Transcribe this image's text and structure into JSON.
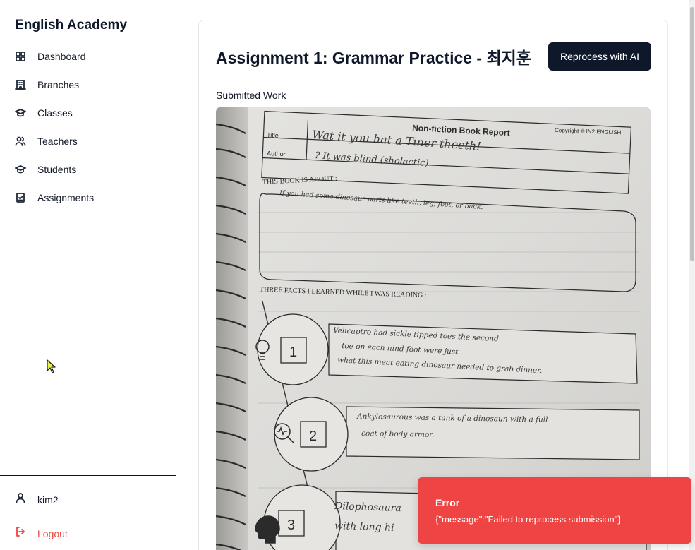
{
  "sidebar": {
    "brand": "English Academy",
    "items": [
      {
        "label": "Dashboard",
        "icon": "dashboard-icon"
      },
      {
        "label": "Branches",
        "icon": "building-icon"
      },
      {
        "label": "Classes",
        "icon": "graduation-cap-icon"
      },
      {
        "label": "Teachers",
        "icon": "users-icon"
      },
      {
        "label": "Students",
        "icon": "graduation-cap-icon"
      },
      {
        "label": "Assignments",
        "icon": "clipboard-check-icon"
      }
    ],
    "user": "kim2",
    "logout": "Logout"
  },
  "main": {
    "title": "Assignment 1: Grammar Practice - 최지훈",
    "reprocess_label": "Reprocess with AI",
    "section_label": "Submitted Work"
  },
  "worksheet": {
    "heading": "Non-fiction Book Report",
    "copyright": "Copyright © IN2 ENGLISH",
    "title_label": "Title",
    "author_label": "Author",
    "title_value": "Wat it you hat a Tiner theeth!",
    "author_value": "? It was blind (sholactic)",
    "about_heading": "THIS BOOK IS ABOUT :",
    "about_text": "If you had some dinosaur parts like teeth, leg, foot, or back.",
    "facts_heading": "THREE FACTS I LEARNED WHILE I WAS READING :",
    "facts": [
      {
        "num": "1",
        "text1": "Velicaptro had sickle tipped toes the second",
        "text2": "toe on each hind foot were just",
        "text3": "what this meat eating dinosaur needed to grab dinner."
      },
      {
        "num": "2",
        "text1": "Ankylosaurous was a tank of a dinosaun with a full",
        "text2": "coat of body armor.",
        "text3": ""
      },
      {
        "num": "3",
        "text1": "Dilophosaura",
        "text2": "with long hi",
        "text3": ""
      }
    ]
  },
  "toast": {
    "title": "Error",
    "message": "{\"message\":\"Failed to reprocess submission\"}"
  },
  "colors": {
    "primary_button": "#0f172a",
    "danger": "#ef4444"
  }
}
